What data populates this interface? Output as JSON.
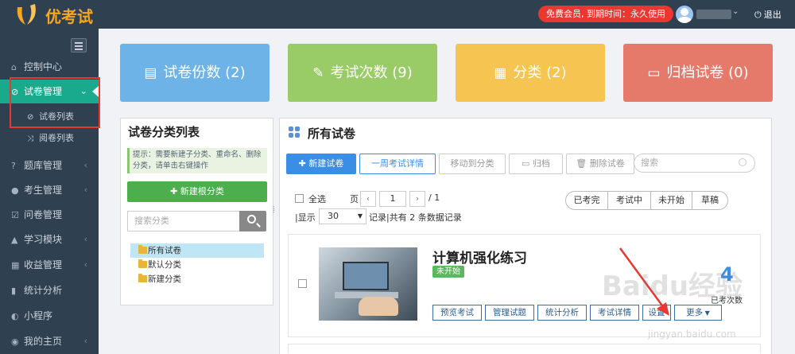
{
  "brand": {
    "name": "优考试"
  },
  "topbar": {
    "vip_badge": "免费会员, 到期时间：永久使用",
    "logout": "退出"
  },
  "sidebar": {
    "items": [
      {
        "label": "控制中心"
      },
      {
        "label": "试卷管理"
      },
      {
        "label": "试卷列表"
      },
      {
        "label": "阅卷列表"
      },
      {
        "label": "题库管理"
      },
      {
        "label": "考生管理"
      },
      {
        "label": "问卷管理"
      },
      {
        "label": "学习模块"
      },
      {
        "label": "收益管理"
      },
      {
        "label": "统计分析"
      },
      {
        "label": "小程序"
      },
      {
        "label": "我的主页"
      }
    ]
  },
  "stats": [
    {
      "label": "试卷份数 (2)",
      "color": "#6db3e8"
    },
    {
      "label": "考试次数 (9)",
      "color": "#99cc66"
    },
    {
      "label": "分类 (2)",
      "color": "#f5c451"
    },
    {
      "label": "归档试卷 (0)",
      "color": "#e67a6a"
    }
  ],
  "category_panel": {
    "title": "试卷分类列表",
    "tip": "提示：需要新建子分类、重命名、删除分类，请单击右键操作",
    "new_root": "新建根分类",
    "search_placeholder": "搜索分类",
    "tree": [
      "所有试卷",
      "默认分类",
      "新建分类"
    ]
  },
  "exam_panel": {
    "title": "所有试卷",
    "toolbar": {
      "new_exam": "新建试卷",
      "weekly": "一周考试详情",
      "move": "移动到分类",
      "archive": "归档",
      "delete": "删除试卷",
      "search_placeholder": "搜索"
    },
    "select_all": "全选",
    "pager": {
      "label_page": "页",
      "current": "1",
      "total": "/ 1"
    },
    "display": {
      "label": "|显示",
      "size": "30",
      "suffix": "记录|共有 2 条数据记录"
    },
    "filters": [
      "已考完",
      "考试中",
      "未开始",
      "草稿"
    ],
    "exam": {
      "title": "计算机强化练习",
      "status": "未开始",
      "count": "4",
      "count_label": "已考次数",
      "actions": [
        "预览考试",
        "管理试题",
        "统计分析",
        "考试详情",
        "设置",
        "更多"
      ]
    }
  },
  "watermark": {
    "text": "Baidu经验",
    "sub": "jingyan.baidu.com"
  },
  "colors": {
    "sidebar": "#2f4050",
    "active": "#19aa8d",
    "primary": "#3a8ee6",
    "highlight": "#e8382f"
  }
}
